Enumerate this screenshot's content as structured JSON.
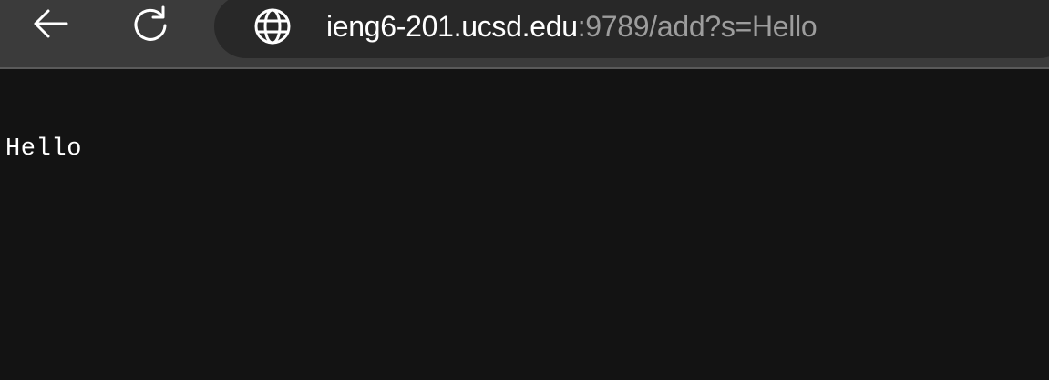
{
  "browser": {
    "back_icon": "arrow-left-icon",
    "reload_icon": "reload-icon",
    "site_icon": "globe-icon",
    "url_host": "ieng6-201.ucsd.edu",
    "url_rest": ":9789/add?s=Hello"
  },
  "page": {
    "body_text": "Hello"
  },
  "colors": {
    "toolbar_bg": "#3b3b3b",
    "address_bg": "#282828",
    "page_bg": "#131313",
    "text": "#ffffff",
    "url_dim": "#9d9d9d"
  }
}
